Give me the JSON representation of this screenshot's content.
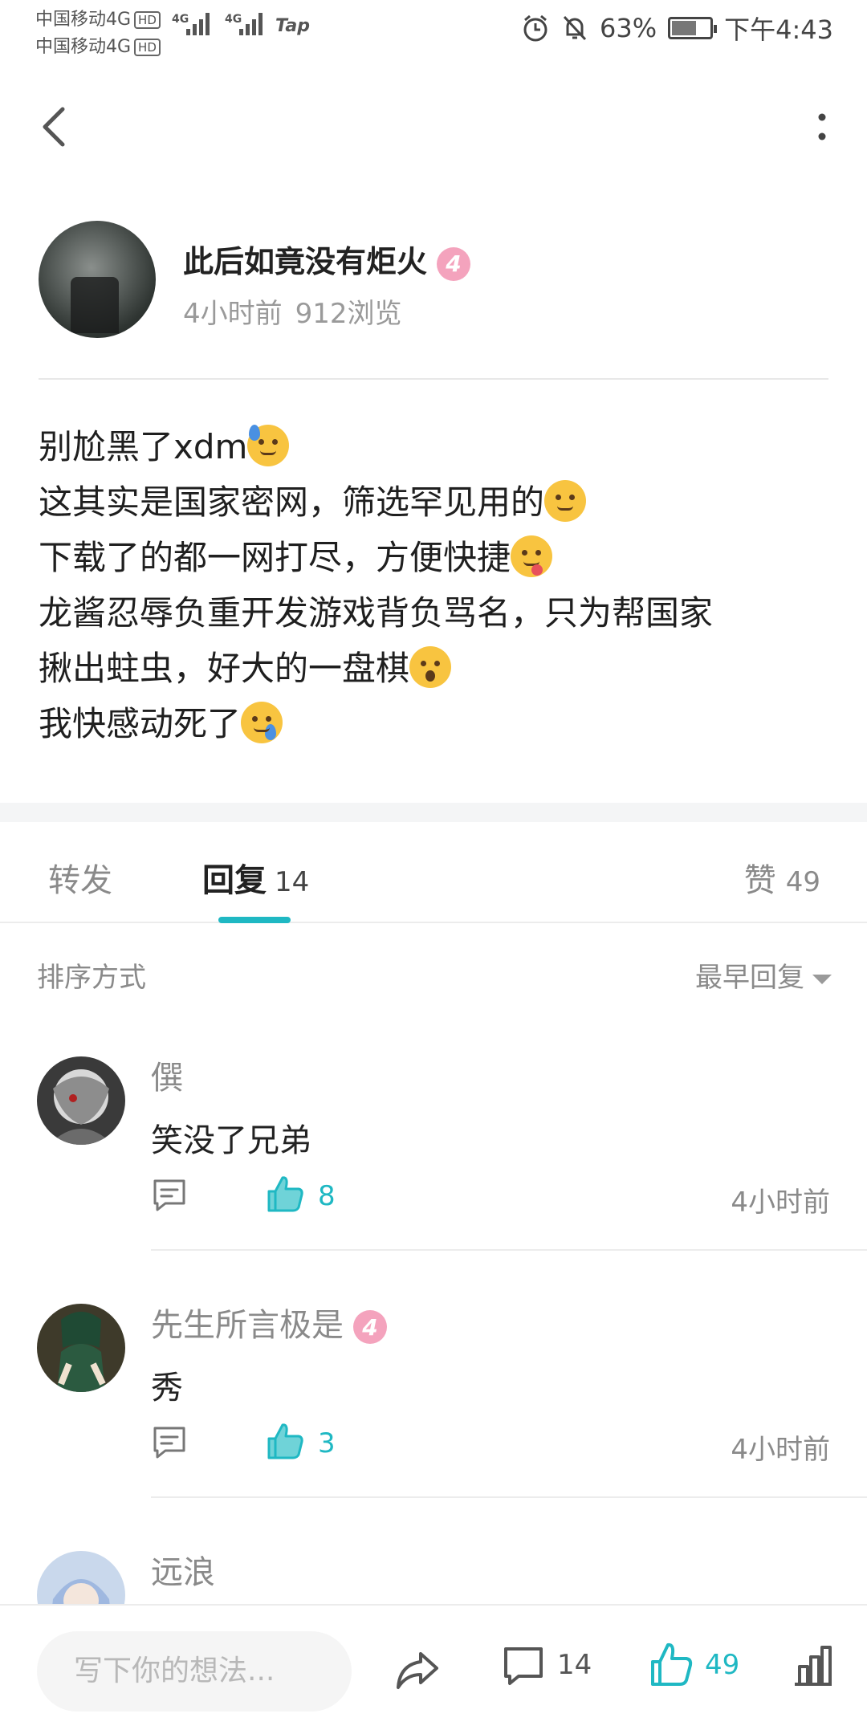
{
  "status_bar": {
    "carrier_1": "中国移动4G",
    "carrier_2": "中国移动4G",
    "hd": "HD",
    "net_1": "4G",
    "net_2": "4G",
    "app_badge": "Tap",
    "battery": "63%",
    "time": "下午4:43"
  },
  "post": {
    "author": "此后如竟没有炬火",
    "level": "4",
    "posted": "4小时前",
    "views": "912浏览",
    "lines": [
      "别尬黑了xdm",
      "这其实是国家密网，筛选罕见用的",
      "下载了的都一网打尽，方便快捷",
      "龙酱忍辱负重开发游戏背负骂名，只为帮国家",
      "揪出蛀虫，好大的一盘棋",
      "我快感动死了"
    ]
  },
  "tabs": {
    "forward": "转发",
    "reply": "回复",
    "reply_count": "14",
    "like": "赞",
    "like_count": "49"
  },
  "sort": {
    "label": "排序方式",
    "value": "最早回复"
  },
  "comments": [
    {
      "name": "僎",
      "level": "",
      "text": "笑没了兄弟",
      "likes": "8",
      "time": "4小时前"
    },
    {
      "name": "先生所言极是",
      "level": "4",
      "text": "秀",
      "likes": "3",
      "time": "4小时前"
    },
    {
      "name": "远浪",
      "level": "",
      "text": "",
      "likes": "",
      "time": ""
    }
  ],
  "bottom_bar": {
    "placeholder": "写下你的想法...",
    "comment_count": "14",
    "like_count": "49"
  },
  "colors": {
    "accent": "#1fb8c3",
    "level_badge": "#f4a3bd"
  }
}
